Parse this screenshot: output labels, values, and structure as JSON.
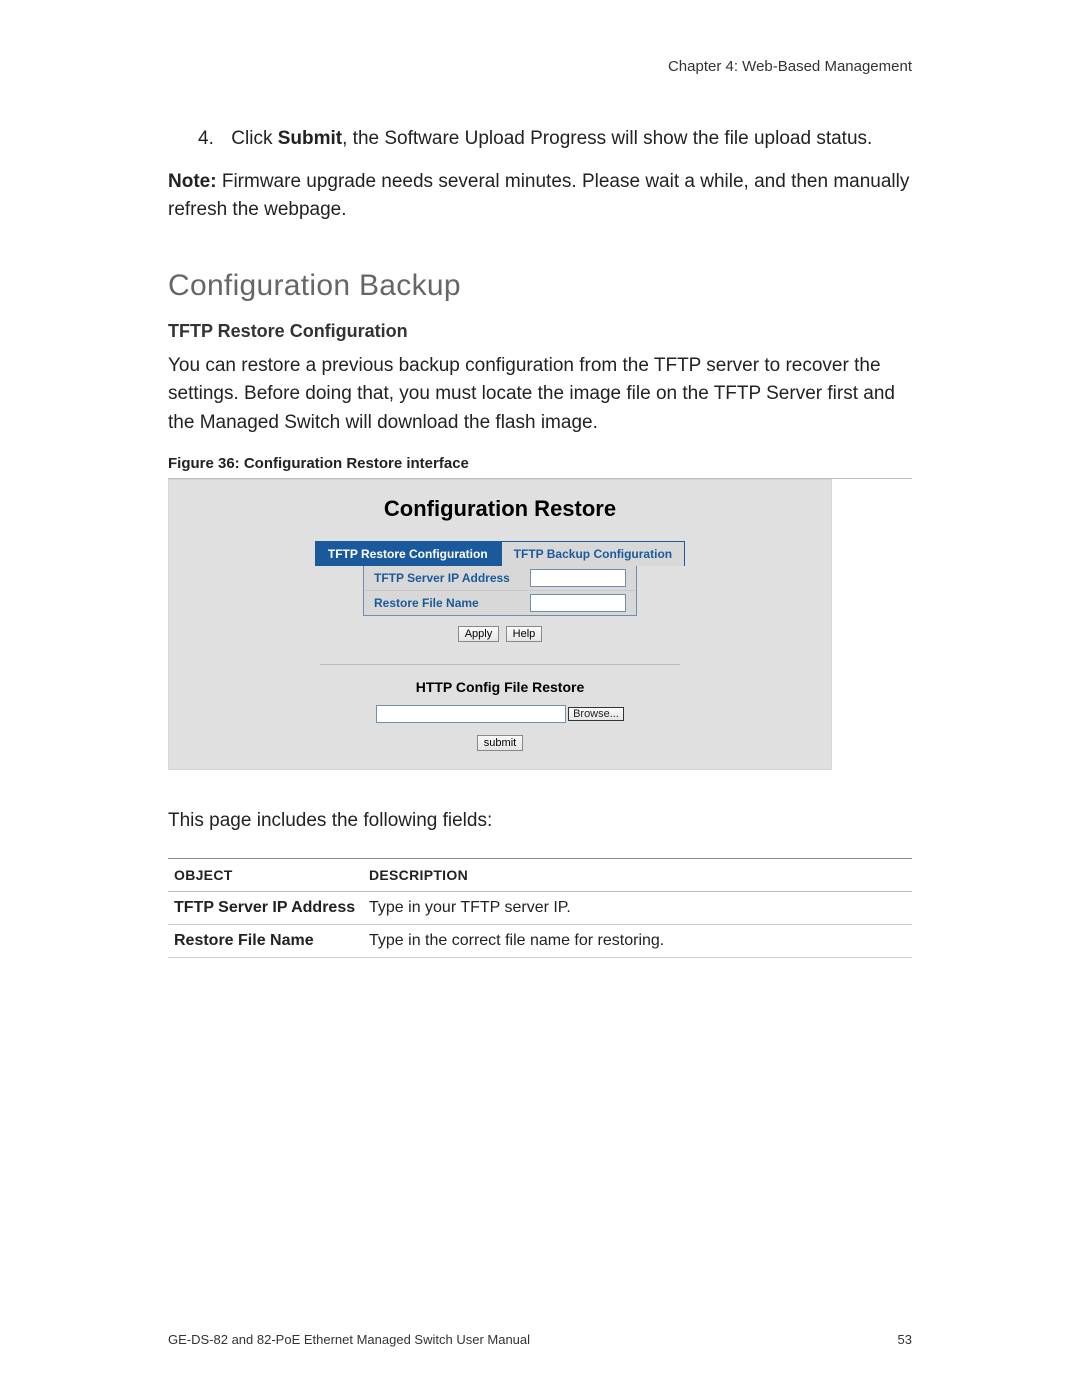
{
  "header": "Chapter 4: Web-Based Management",
  "step": {
    "num": "4.",
    "pre": "Click ",
    "bold": "Submit",
    "post": ", the Software Upload Progress will show the file upload status."
  },
  "note_bold": "Note:",
  "note_text": " Firmware upgrade needs several minutes. Please wait a while, and then manually refresh the webpage.",
  "section_title": "Configuration Backup",
  "subsection": "TFTP Restore Configuration",
  "body_text": "You can restore a previous backup configuration from the TFTP server to recover the settings. Before doing that, you must locate the image file on the TFTP Server first and the Managed Switch will download the flash image.",
  "figure_caption": "Figure 36: Configuration Restore interface",
  "screenshot": {
    "title": "Configuration Restore",
    "tab_active": "TFTP Restore Configuration",
    "tab_inactive": "TFTP Backup Configuration",
    "row1_label": "TFTP Server IP Address",
    "row2_label": "Restore File Name",
    "apply": "Apply",
    "help": "Help",
    "sub_title": "HTTP Config File Restore",
    "browse": "Browse...",
    "submit": "submit"
  },
  "after_figure": "This page includes the following fields:",
  "table": {
    "h1": "OBJECT",
    "h2": "DESCRIPTION",
    "rows": [
      {
        "obj": "TFTP Server IP Address",
        "desc": "Type in your TFTP server IP."
      },
      {
        "obj": "Restore File Name",
        "desc": "Type in the correct file name for restoring."
      }
    ]
  },
  "footer_left": "GE-DS-82 and 82-PoE Ethernet Managed Switch User Manual",
  "footer_right": "53"
}
